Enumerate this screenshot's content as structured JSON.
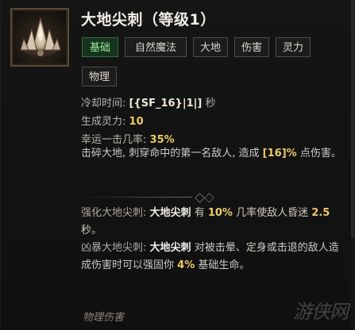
{
  "skill": {
    "title": "大地尖刺（等级1）",
    "icon": "earth-spike-icon"
  },
  "tags": [
    {
      "label": "基础",
      "primary": true
    },
    {
      "label": "自然魔法"
    },
    {
      "label": "大地"
    },
    {
      "label": "伤害"
    },
    {
      "label": "灵力"
    },
    {
      "label": "物理"
    }
  ],
  "stats": {
    "cooldown_label": "冷却时间:",
    "cooldown_value": "[{SF_16}|1|]",
    "cooldown_unit": "秒",
    "spirit_label": "生成灵力:",
    "spirit_value": "10",
    "luck_label": "幸运一击几率:",
    "luck_value": "35%"
  },
  "description": {
    "text_1": "击碎大地, 刺穿命中的第一名敌人, 造成",
    "damage_value": "[16]%",
    "text_2": "点伤害。"
  },
  "enhancements": {
    "enhanced_label": "强化大地尖刺:",
    "enhanced_skill": "大地尖刺",
    "enhanced_text_1": "有",
    "enhanced_chance": "10%",
    "enhanced_text_2": "几率使敌人昏迷",
    "enhanced_duration": "2.5",
    "enhanced_text_3": "秒。",
    "fierce_label": "凶暴大地尖刺:",
    "fierce_skill": "大地尖刺",
    "fierce_text_1": "对被击晕、定身或击退的敌人造成伤害时可以强固你",
    "fierce_value": "4%",
    "fierce_text_2": "基础生命。"
  },
  "footer": {
    "damage_type": "物理伤害"
  },
  "watermark": {
    "text": "游侠网"
  }
}
